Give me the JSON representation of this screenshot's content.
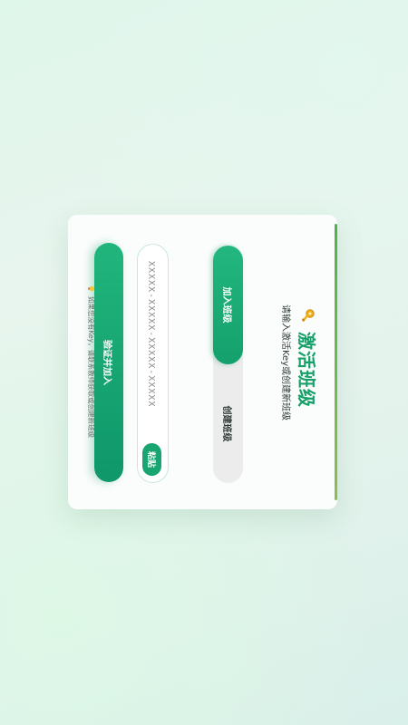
{
  "dialog": {
    "title": "激活班级",
    "subtitle": "请输入激活Key或创建新班级",
    "title_icon": "key-icon",
    "accent_color": "#17a06a"
  },
  "tabs": [
    {
      "label": "加入班级",
      "selected": true
    },
    {
      "label": "创建班级",
      "selected": false
    }
  ],
  "key_input": {
    "placeholder": "XXXXX-XXXXX-XXXXX-XXXXX",
    "value": ""
  },
  "paste_button": {
    "label": "粘贴"
  },
  "verify_button": {
    "label": "验证并加入"
  },
  "hint": {
    "icon": "lightbulb-icon",
    "text": "如果您没有Key，请联系教师获取或创建新班级"
  }
}
